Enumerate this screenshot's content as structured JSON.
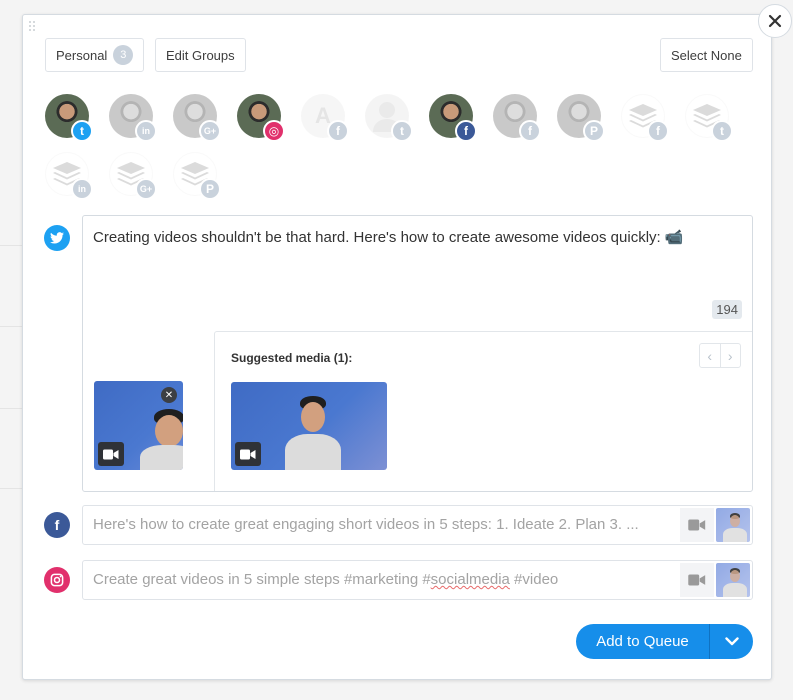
{
  "header": {
    "group_button": {
      "label": "Personal",
      "count": "3"
    },
    "edit_groups_label": "Edit Groups",
    "select_none_label": "Select None",
    "close_icon": "close-icon"
  },
  "profiles": [
    {
      "type": "photo",
      "network": "twitter",
      "active": true
    },
    {
      "type": "photo",
      "network": "linkedin",
      "active": false
    },
    {
      "type": "photo",
      "network": "google-plus",
      "active": false
    },
    {
      "type": "photo",
      "network": "instagram",
      "active": true
    },
    {
      "type": "letter",
      "letter": "A",
      "network": "facebook",
      "active": false
    },
    {
      "type": "silhouette",
      "network": "twitter",
      "active": false
    },
    {
      "type": "photo",
      "network": "facebook",
      "active": true
    },
    {
      "type": "photo",
      "network": "facebook",
      "active": false
    },
    {
      "type": "photo",
      "network": "pinterest",
      "active": false
    },
    {
      "type": "stack",
      "network": "facebook",
      "active": false
    },
    {
      "type": "stack",
      "network": "twitter",
      "active": false
    },
    {
      "type": "stack",
      "network": "linkedin",
      "active": false
    },
    {
      "type": "stack",
      "network": "google-plus",
      "active": false
    },
    {
      "type": "stack",
      "network": "pinterest",
      "active": false
    }
  ],
  "network_colors": {
    "twitter": "#1da1f2",
    "facebook": "#3b5998",
    "instagram": "#e1306c",
    "inactive": "#c9d2dc",
    "accent": "#168eea"
  },
  "network_glyphs": {
    "twitter": "t",
    "linkedin": "in",
    "google-plus": "G+",
    "instagram": "◎",
    "facebook": "f",
    "pinterest": "P"
  },
  "twitter_composer": {
    "text": "Creating videos shouldn't be that hard. Here's how to create awesome videos quickly: 📹",
    "char_count": "194",
    "attached_media": {
      "type": "video"
    },
    "suggested_media_label": "Suggested media (1):",
    "pager_prev": "‹",
    "pager_next": "›"
  },
  "facebook_composer": {
    "text": "Here's how to create great engaging short videos in 5 steps: 1. Ideate 2. Plan 3. ..."
  },
  "instagram_composer": {
    "text_before": "Create great videos in 5 simple steps #marketing #",
    "text_misspelled": "socialmedia",
    "text_after": " #video"
  },
  "footer": {
    "add_to_queue_label": "Add to Queue"
  }
}
